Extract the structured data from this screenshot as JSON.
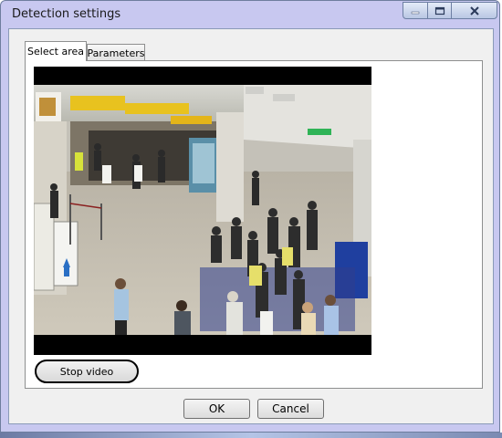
{
  "window": {
    "title": "Detection settings",
    "controls": {
      "minimize_icon": "minimize-icon",
      "maximize_icon": "maximize-icon",
      "close_icon": "close-icon"
    }
  },
  "tabs": [
    {
      "label": "Select area",
      "selected": true
    },
    {
      "label": "Parameters",
      "selected": false
    }
  ],
  "video": {
    "stop_label": "Stop video"
  },
  "footer": {
    "ok_label": "OK",
    "cancel_label": "Cancel"
  },
  "colors": {
    "window_frame": "#c8c8f0",
    "client_bg": "#f0f0f0",
    "panel_bg": "#ffffff",
    "video_letterbox": "#000000"
  }
}
